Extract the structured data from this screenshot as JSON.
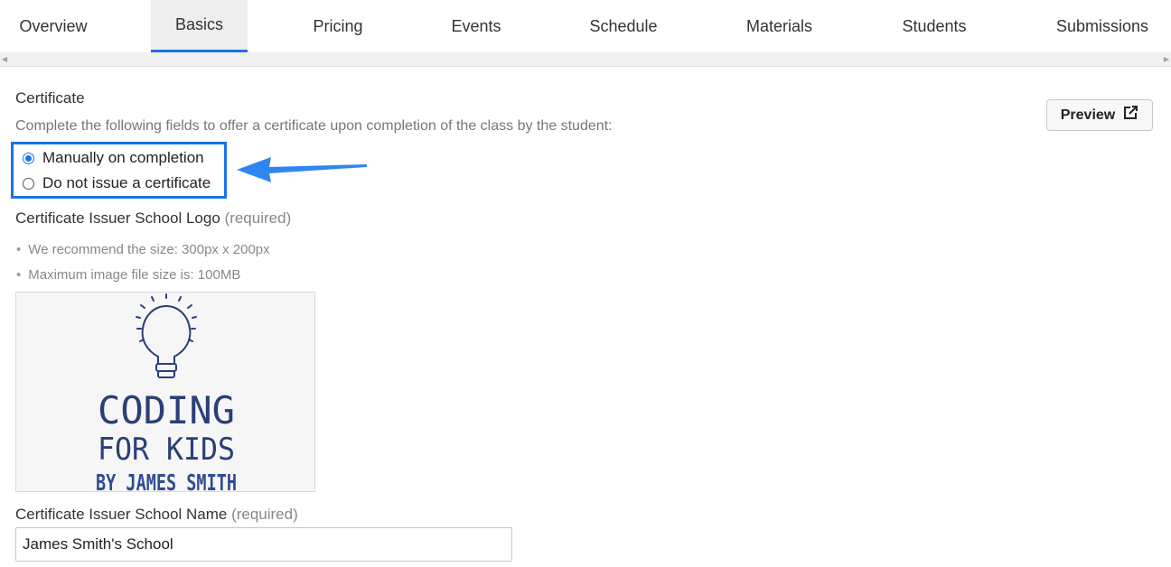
{
  "tabs": [
    {
      "label": "Overview",
      "active": false
    },
    {
      "label": "Basics",
      "active": true
    },
    {
      "label": "Pricing",
      "active": false
    },
    {
      "label": "Events",
      "active": false
    },
    {
      "label": "Schedule",
      "active": false
    },
    {
      "label": "Materials",
      "active": false
    },
    {
      "label": "Students",
      "active": false
    },
    {
      "label": "Submissions",
      "active": false
    }
  ],
  "certificate": {
    "title": "Certificate",
    "description": "Complete the following fields to offer a certificate upon completion of the class by the student:",
    "preview_label": "Preview",
    "preview_icon": "external-link-icon",
    "options": [
      {
        "label": "Manually on completion",
        "selected": true
      },
      {
        "label": "Do not issue a certificate",
        "selected": false
      }
    ],
    "highlight_color": "#1a73e8"
  },
  "logo_field": {
    "label": "Certificate Issuer School Logo",
    "required": "(required)",
    "hints": [
      "We recommend the size: 300px x 200px",
      "Maximum image file size is: 100MB"
    ],
    "logo_text": {
      "line1": "CODING",
      "line2": "FOR KIDS",
      "line3": "BY JAMES SMITH"
    }
  },
  "name_field": {
    "label": "Certificate Issuer School Name",
    "required": "(required)",
    "value": "James Smith's School"
  }
}
